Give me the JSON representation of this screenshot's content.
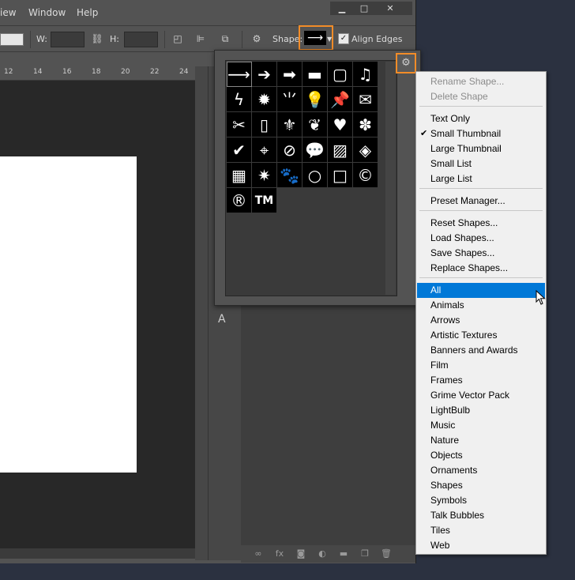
{
  "menubar": {
    "items": [
      "iew",
      "Window",
      "Help"
    ],
    "minimize_icon": "minimize-icon",
    "maximize_icon": "maximize-icon",
    "close_icon": "close-icon"
  },
  "options_bar": {
    "w_label": "W:",
    "h_label": "H:",
    "w_value": "",
    "h_value": "",
    "shape_label": "Shape:",
    "shape_value_glyph": "⟶",
    "align_edges_label": "Align Edges",
    "align_edges_checked": true,
    "accent_color": "#f28c28"
  },
  "ruler": {
    "ticks": [
      "12",
      "14",
      "16",
      "18",
      "20",
      "22",
      "24"
    ]
  },
  "shape_picker": {
    "gear_icon": "gear-icon",
    "shapes": [
      {
        "name": "arrow-thin",
        "glyph": "⟶"
      },
      {
        "name": "arrow-medium",
        "glyph": "➔"
      },
      {
        "name": "arrow-bold",
        "glyph": "➡"
      },
      {
        "name": "banner",
        "glyph": "▬"
      },
      {
        "name": "frame-rough",
        "glyph": "▢"
      },
      {
        "name": "music-note",
        "glyph": "♫"
      },
      {
        "name": "lightning",
        "glyph": "ϟ"
      },
      {
        "name": "starburst",
        "glyph": "✹"
      },
      {
        "name": "grass",
        "glyph": "⺌"
      },
      {
        "name": "light-bulb",
        "glyph": "💡"
      },
      {
        "name": "thumbtack",
        "glyph": "📌"
      },
      {
        "name": "envelope",
        "glyph": "✉"
      },
      {
        "name": "scissors",
        "glyph": "✂"
      },
      {
        "name": "stamp-frame",
        "glyph": "▯"
      },
      {
        "name": "fleur-de-lis",
        "glyph": "⚜"
      },
      {
        "name": "puzzle-ornament",
        "glyph": "❦"
      },
      {
        "name": "heart",
        "glyph": "♥"
      },
      {
        "name": "blob",
        "glyph": "✽"
      },
      {
        "name": "checkmark",
        "glyph": "✔"
      },
      {
        "name": "target",
        "glyph": "⌖"
      },
      {
        "name": "no-sign",
        "glyph": "⊘"
      },
      {
        "name": "speech-bubble",
        "glyph": "💬"
      },
      {
        "name": "diagonal-texture",
        "glyph": "▨"
      },
      {
        "name": "diamond-tiles",
        "glyph": "◈"
      },
      {
        "name": "grid",
        "glyph": "▦"
      },
      {
        "name": "burst",
        "glyph": "✷"
      },
      {
        "name": "paw-print",
        "glyph": "🐾"
      },
      {
        "name": "circle-frame",
        "glyph": "○"
      },
      {
        "name": "square-frame",
        "glyph": "□"
      },
      {
        "name": "copyright",
        "glyph": "©"
      },
      {
        "name": "registered",
        "glyph": "®"
      },
      {
        "name": "trademark",
        "glyph": "TM"
      }
    ]
  },
  "context_menu": {
    "sections": [
      [
        {
          "label": "Rename Shape...",
          "disabled": true
        },
        {
          "label": "Delete Shape",
          "disabled": true
        }
      ],
      [
        {
          "label": "Text Only"
        },
        {
          "label": "Small Thumbnail",
          "checked": true
        },
        {
          "label": "Large Thumbnail"
        },
        {
          "label": "Small List"
        },
        {
          "label": "Large List"
        }
      ],
      [
        {
          "label": "Preset Manager..."
        }
      ],
      [
        {
          "label": "Reset Shapes..."
        },
        {
          "label": "Load Shapes..."
        },
        {
          "label": "Save Shapes..."
        },
        {
          "label": "Replace Shapes..."
        }
      ],
      [
        {
          "label": "All",
          "highlighted": true
        },
        {
          "label": "Animals"
        },
        {
          "label": "Arrows"
        },
        {
          "label": "Artistic Textures"
        },
        {
          "label": "Banners and Awards"
        },
        {
          "label": "Film"
        },
        {
          "label": "Frames"
        },
        {
          "label": "Grime Vector Pack"
        },
        {
          "label": "LightBulb"
        },
        {
          "label": "Music"
        },
        {
          "label": "Nature"
        },
        {
          "label": "Objects"
        },
        {
          "label": "Ornaments"
        },
        {
          "label": "Shapes"
        },
        {
          "label": "Symbols"
        },
        {
          "label": "Talk Bubbles"
        },
        {
          "label": "Tiles"
        },
        {
          "label": "Web"
        }
      ]
    ],
    "highlight_color": "#0078d7"
  }
}
